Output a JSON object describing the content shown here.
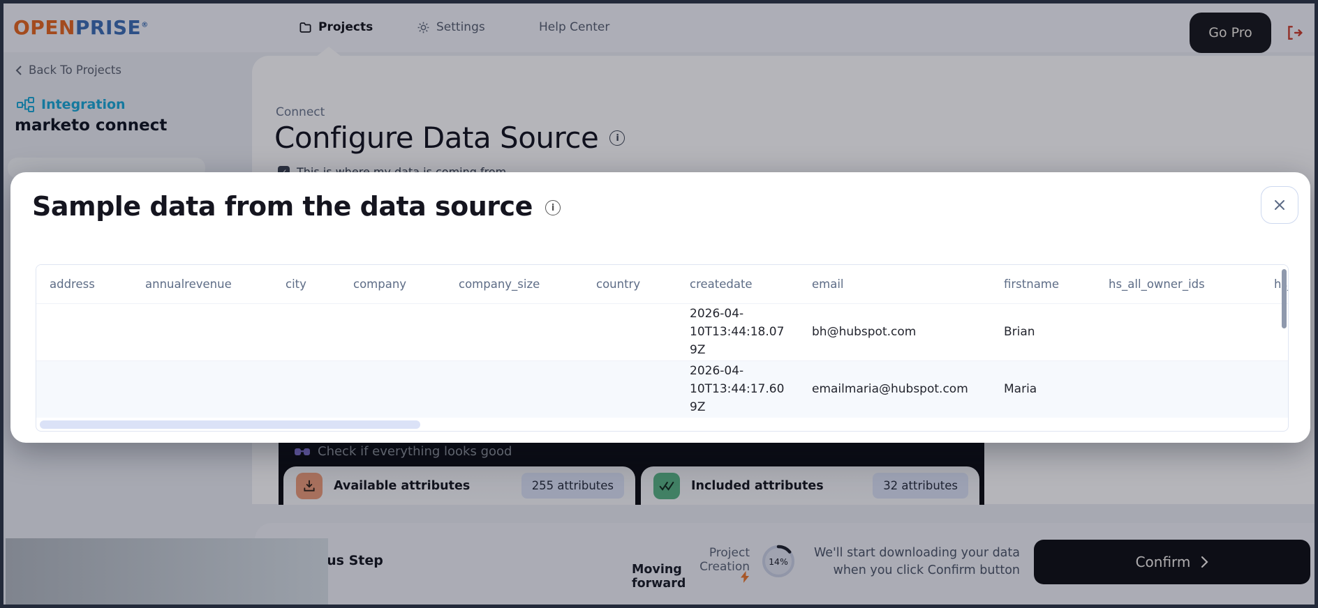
{
  "header": {
    "logo": {
      "part1": "OPEN",
      "part2": "PRISE",
      "registered": "®"
    },
    "nav": [
      {
        "label": "Projects",
        "icon": "folder-icon",
        "active": true
      },
      {
        "label": "Settings",
        "icon": "gear-icon",
        "active": false
      },
      {
        "label": "Help Center",
        "icon": "",
        "active": false
      }
    ],
    "go_pro_label": "Go Pro",
    "logout_icon": "logout-icon"
  },
  "sidebar": {
    "back_link": "Back To Projects",
    "project_type": "Integration",
    "project_name": "marketo connect"
  },
  "page": {
    "eyebrow": "Connect",
    "title": "Configure Data Source",
    "checkbox_label": "This is where my data is coming from",
    "checkbox_checked": "✓"
  },
  "modal": {
    "title": "Sample data from the data source",
    "close_icon": "×",
    "table": {
      "columns": [
        "address",
        "annualrevenue",
        "city",
        "company",
        "company_size",
        "country",
        "createdate",
        "email",
        "firstname",
        "hs_all_owner_ids",
        "hs_"
      ],
      "rows": [
        {
          "cells": [
            "",
            "",
            "",
            "",
            "",
            "",
            "2026-04-10T13:44:18.079Z",
            "bh@hubspot.com",
            "Brian",
            "",
            ""
          ]
        },
        {
          "cells": [
            "",
            "",
            "",
            "",
            "",
            "",
            "2026-04-10T13:44:17.609Z",
            "emailmaria@hubspot.com",
            "Maria",
            "",
            ""
          ]
        }
      ]
    }
  },
  "attributes_panel": {
    "heading": "Check if everything looks good",
    "cards": [
      {
        "label": "Available attributes",
        "badge": "255 attributes",
        "icon": "download-icon"
      },
      {
        "label": "Included attributes",
        "badge": "32 attributes",
        "icon": "double-check-icon"
      }
    ]
  },
  "footer": {
    "previous_label": "Previous Step",
    "project_creation": "Project Creation",
    "moving_forward": "Moving forward",
    "progress_percent": "14%",
    "note_line1": "We'll start downloading your data",
    "note_line2": "when you click Confirm button",
    "confirm_label": "Confirm"
  },
  "colors": {
    "brand_orange": "#e2651f",
    "brand_blue": "#3a6cb3",
    "accent_cyan": "#18a6d6",
    "danger_red": "#c93a2a",
    "dark_button": "#0c0d13",
    "salmon_icon": "#e99a79",
    "green_icon": "#57b183",
    "badge_bg": "#d9e0f4",
    "row_alt_bg": "#f6f9fd"
  }
}
